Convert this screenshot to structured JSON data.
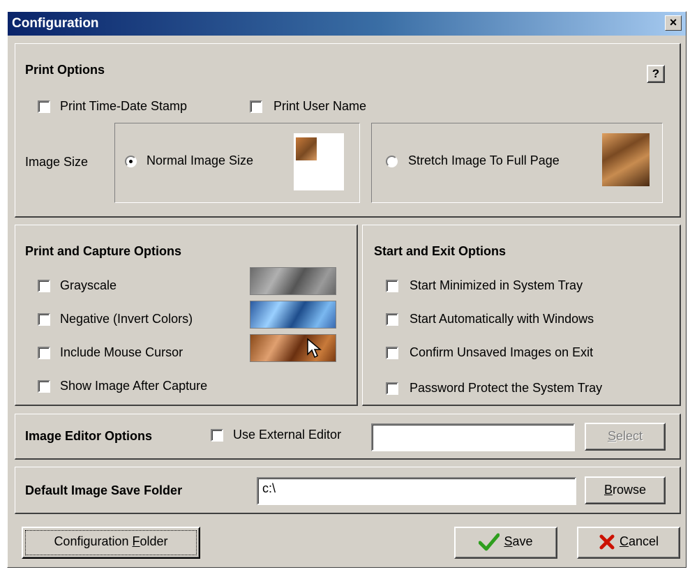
{
  "window": {
    "title": "Configuration",
    "close_label": "×"
  },
  "print_options": {
    "title": "Print Options",
    "help_label": "?",
    "time_date_stamp": {
      "label": "Print Time-Date Stamp",
      "checked": false
    },
    "user_name": {
      "label": "Print User Name",
      "checked": false
    },
    "image_size_label": "Image Size",
    "normal_size": {
      "label": "Normal Image Size",
      "selected": true
    },
    "stretch_size": {
      "label": "Stretch Image To Full Page",
      "selected": false
    }
  },
  "capture_options": {
    "title": "Print and Capture Options",
    "items": [
      {
        "label": "Grayscale",
        "checked": false
      },
      {
        "label": "Negative (Invert Colors)",
        "checked": false
      },
      {
        "label": "Include Mouse Cursor",
        "checked": false
      },
      {
        "label": "Show Image After Capture",
        "checked": false
      }
    ]
  },
  "start_exit_options": {
    "title": "Start and Exit Options",
    "items": [
      {
        "label": "Start Minimized  in System Tray",
        "checked": false
      },
      {
        "label": "Start Automatically with Windows",
        "checked": false
      },
      {
        "label": "Confirm Unsaved Images on Exit",
        "checked": false
      },
      {
        "label": "Password Protect the System Tray",
        "checked": false
      }
    ]
  },
  "image_editor": {
    "title": "Image Editor Options",
    "use_external": {
      "label": "Use External Editor",
      "checked": false
    },
    "path_value": "",
    "select_label": {
      "accel": "S",
      "rest": "elect"
    }
  },
  "save_folder": {
    "title": "Default Image Save Folder",
    "path_value": "c:\\",
    "browse_label": {
      "accel": "B",
      "rest": "rowse"
    }
  },
  "footer": {
    "config_folder_label": {
      "pre": "Configuration ",
      "accel": "F",
      "rest": "older"
    },
    "save_label": {
      "accel": "S",
      "rest": "ave"
    },
    "cancel_label": {
      "accel": "C",
      "rest": "ancel"
    }
  },
  "colors": {
    "dialog_bg": "#d4d0c8",
    "titlebar_start": "#0a246a",
    "titlebar_end": "#a6caf0",
    "save_check": "#2e9e1e",
    "cancel_x": "#cc1100",
    "disabled_text": "#808080"
  },
  "icons": {
    "close": "close-icon",
    "help": "help-icon",
    "save": "checkmark-icon",
    "cancel": "x-icon"
  }
}
